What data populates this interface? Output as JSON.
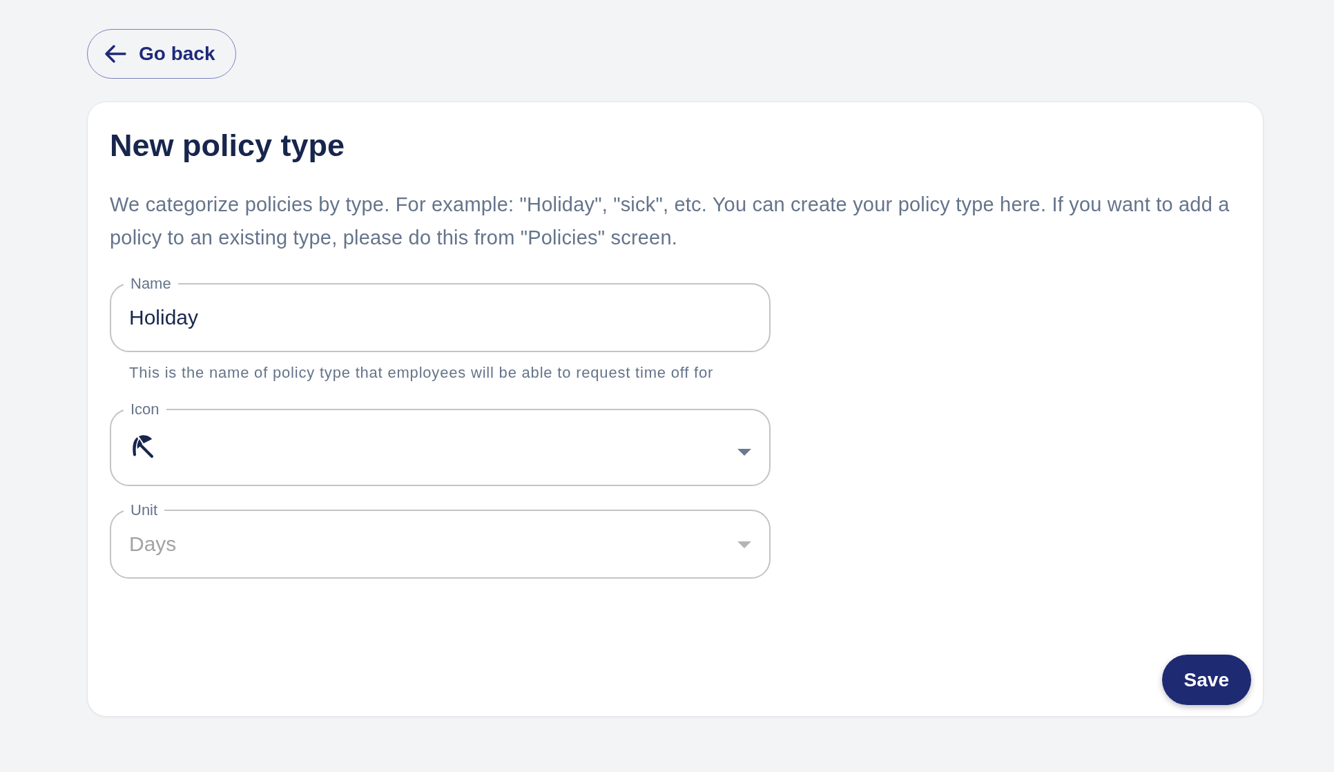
{
  "back_button": {
    "label": "Go back"
  },
  "card": {
    "title": "New policy type",
    "description": "We categorize policies by type. For example: \"Holiday\", \"sick\", etc. You can create your policy type here. If you want to add a policy to an existing type, please do this from \"Policies\" screen.",
    "fields": [
      {
        "kind": "text",
        "label": "Name",
        "value": "Holiday",
        "helper": "This is the name of policy type that employees will be able to request time off for",
        "disabled": false
      },
      {
        "kind": "icon-select",
        "label": "Icon",
        "disabled": false
      },
      {
        "kind": "select",
        "label": "Unit",
        "value": "Days",
        "disabled": true
      }
    ],
    "save_button": {
      "label": "Save"
    }
  }
}
